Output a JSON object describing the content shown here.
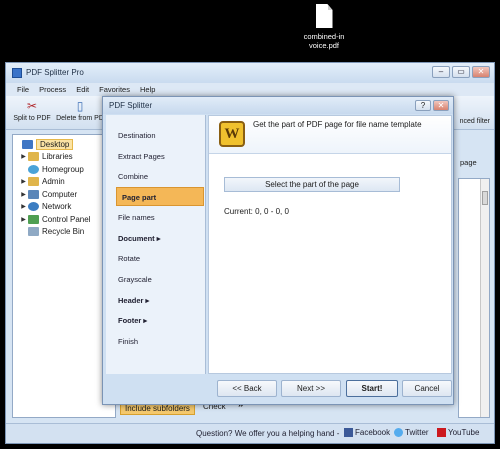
{
  "desktop": {
    "file_name": "combined-in voice.pdf"
  },
  "app": {
    "title": "PDF Splitter Pro"
  },
  "window_buttons": {
    "minimize": "–",
    "restore": "▭",
    "close": "✕"
  },
  "menu": [
    "File",
    "Process",
    "Edit",
    "Favorites",
    "Help"
  ],
  "toolbar": {
    "split_label": "Split to PDF",
    "delete_label": "Delete from PD",
    "advanced_filter_label": "nced filter"
  },
  "tree": {
    "root": "Desktop",
    "items": [
      {
        "label": "Libraries",
        "arrow": "▶"
      },
      {
        "label": "Homegroup",
        "arrow": ""
      },
      {
        "label": "Admin",
        "arrow": "▶"
      },
      {
        "label": "Computer",
        "arrow": "▶"
      },
      {
        "label": "Network",
        "arrow": "▶"
      },
      {
        "label": "Control Panel",
        "arrow": "▶"
      },
      {
        "label": "Recycle Bin",
        "arrow": ""
      }
    ]
  },
  "right_panel": {
    "label": "page"
  },
  "bottom": {
    "include_subfolders": "Include subfolders",
    "check": "Check",
    "more": "»"
  },
  "status": {
    "text": "Question? We offer you a helping hand -",
    "facebook": "Facebook",
    "twitter": "Twitter",
    "youtube": "YouTube"
  },
  "dialog": {
    "title": "PDF Splitter",
    "help_btn": "?",
    "close_btn": "✕",
    "nav": [
      {
        "label": "Destination",
        "bold": false
      },
      {
        "label": "Extract Pages",
        "bold": false
      },
      {
        "label": "Combine",
        "bold": false
      },
      {
        "label": "Page part",
        "bold": true,
        "active": true
      },
      {
        "label": "File names",
        "bold": false
      },
      {
        "label": "Document ▸",
        "bold": true
      },
      {
        "label": "Rotate",
        "bold": false
      },
      {
        "label": "Grayscale",
        "bold": false
      },
      {
        "label": "Header ▸",
        "bold": true
      },
      {
        "label": "Footer ▸",
        "bold": true
      },
      {
        "label": "Finish",
        "bold": false
      }
    ],
    "heading": "Get the part of PDF page for file name template",
    "icon_letter": "W",
    "select_button": "Select the part of the page",
    "current": "Current: 0, 0 - 0, 0",
    "back": "<< Back",
    "next": "Next >>",
    "start": "Start!",
    "cancel": "Cancel"
  },
  "colors": {
    "accent": "#f4b757",
    "chrome": "#d6e4f3",
    "facebook": "#3b5998",
    "twitter": "#55acee",
    "youtube": "#cc181e"
  }
}
